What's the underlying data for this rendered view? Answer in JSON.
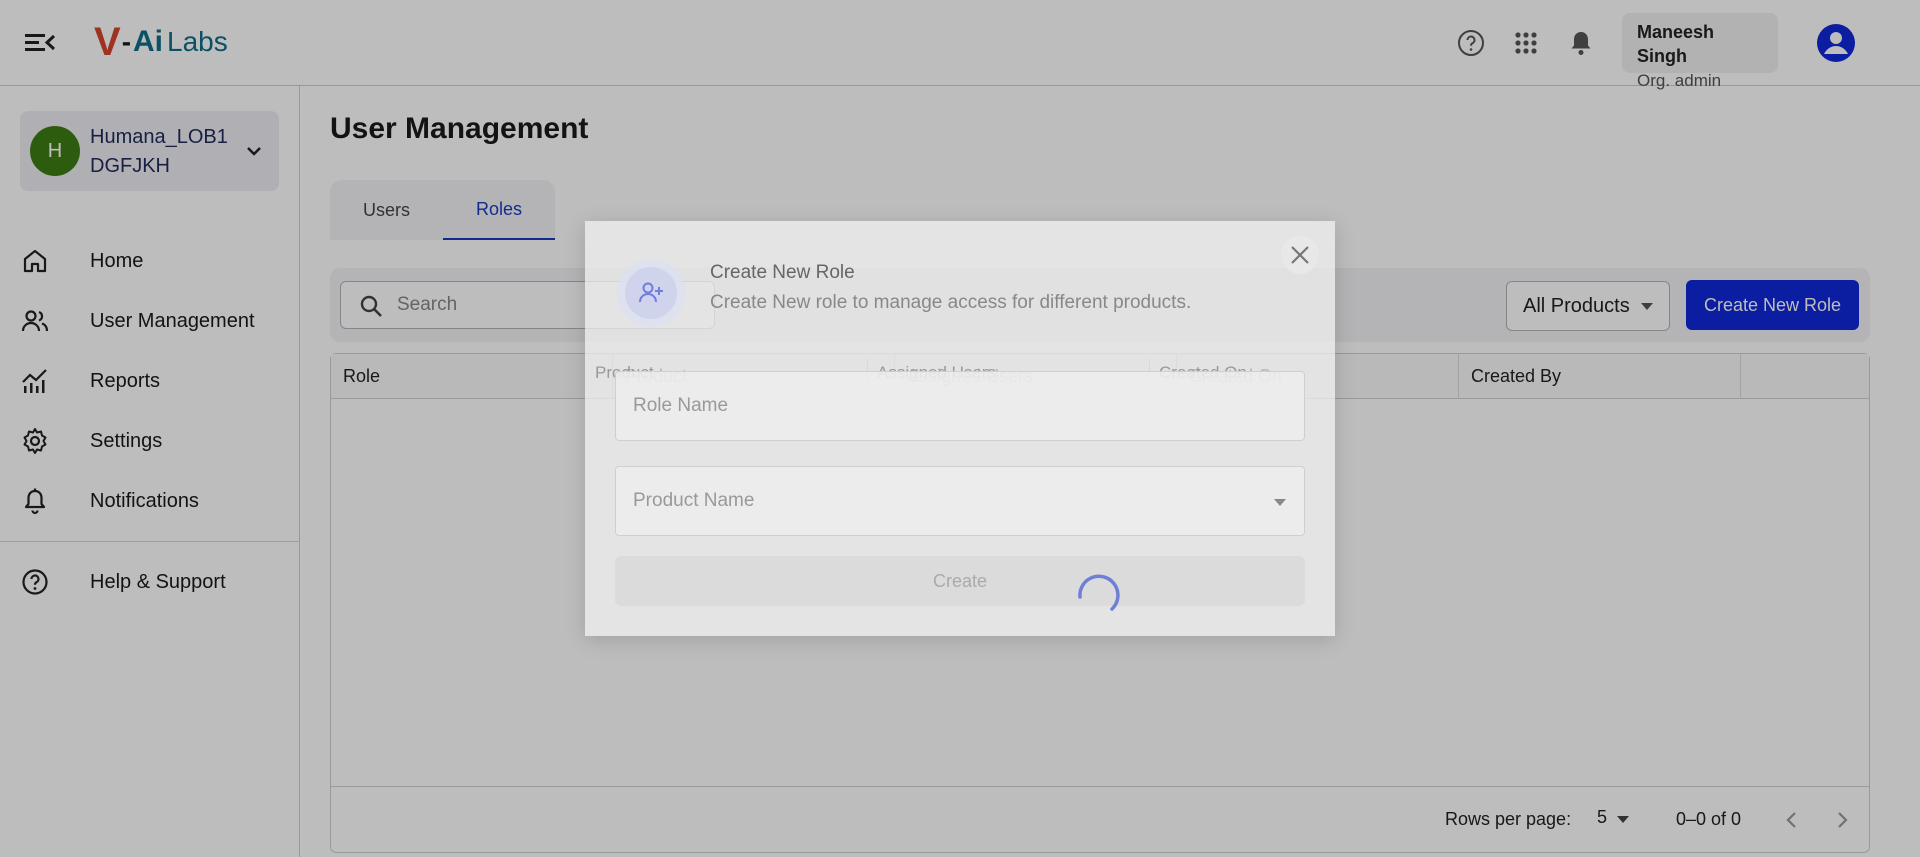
{
  "header": {
    "logo": {
      "v": "V",
      "dash": "-",
      "ai": "Ai",
      "labs": "Labs"
    },
    "user": {
      "name": "Maneesh Singh",
      "role": "Org. admin"
    }
  },
  "sidebar": {
    "org": {
      "initial": "H",
      "name_line1": "Humana_LOB1",
      "name_line2": "DGFJKH"
    },
    "items": [
      {
        "label": "Home",
        "icon": "home-icon"
      },
      {
        "label": "User Management",
        "icon": "users-icon"
      },
      {
        "label": "Reports",
        "icon": "chart-icon"
      },
      {
        "label": "Settings",
        "icon": "gear-icon"
      },
      {
        "label": "Notifications",
        "icon": "bell-icon"
      },
      {
        "label": "Help & Support",
        "icon": "help-icon"
      }
    ]
  },
  "main": {
    "title": "User Management",
    "tabs": [
      {
        "label": "Users"
      },
      {
        "label": "Roles"
      }
    ],
    "active_tab": "Roles",
    "search": {
      "placeholder": "Search",
      "value": ""
    },
    "filter": {
      "selected": "All Products"
    },
    "create_button": "Create New Role",
    "table": {
      "columns": [
        "Role",
        "Product",
        "Assigned Users",
        "Created On",
        "Created By",
        ""
      ],
      "rows": []
    },
    "pagination": {
      "rows_per_page_label": "Rows per page:",
      "rows_per_page": "5",
      "range": "0–0 of 0"
    }
  },
  "modal": {
    "title": "Create New Role",
    "subtitle": "Create New role to manage access for different products.",
    "role_name_placeholder": "Role Name",
    "product_name_placeholder": "Product Name",
    "create_label": "Create",
    "loading": true
  },
  "colors": {
    "primary": "#1028d8",
    "org_avatar": "#3e7d14",
    "active_tab": "#1a3bbf"
  }
}
